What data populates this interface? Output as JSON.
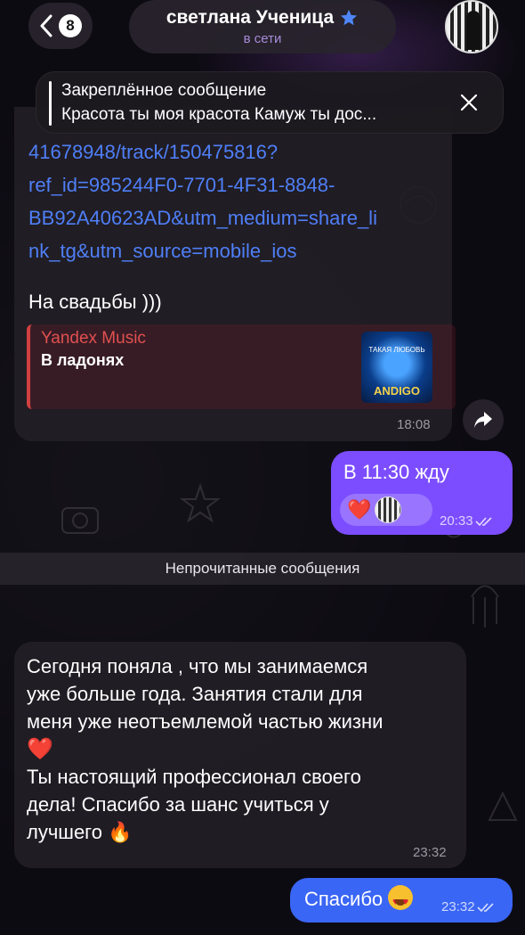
{
  "header": {
    "unread_count": "8",
    "chat_name": "светлана Ученица",
    "status": "в сети",
    "star_icon": "star-icon",
    "back_icon": "chevron-left-icon"
  },
  "pinned": {
    "title": "Закреплённое сообщение",
    "text": "Красота ты моя красота Камуж ты дос..."
  },
  "messages": [
    {
      "link": "41678948/track/150475816?ref_id=985244F0-7701-4F31-8848-BB92A40623AD&utm_medium=share_link_tg&utm_source=mobile_ios",
      "link_lines": [
        "41678948/track/150475816?",
        "ref_id=985244F0-7701-4F31-8848-",
        "BB92A40623AD&utm_medium=share_li",
        "nk_tg&utm_source=mobile_ios"
      ],
      "text": "На свадьбы )))",
      "preview": {
        "site": "Yandex Music",
        "title": "В ладонях",
        "cover_title": "ТАКАЯ ЛЮБОВЬ",
        "cover_artist": "ANDIGO"
      },
      "time": "18:08"
    },
    {
      "text": "В 11:30 жду",
      "reaction": "❤️",
      "time": "20:33"
    },
    {
      "text_lines": [
        "Сегодня поняла , что мы занимаемся",
        "уже больше года. Занятия стали для",
        "меня уже неотъемлемой частью жизни",
        "❤️",
        "Ты настоящий профессионал своего",
        "дела! Спасибо за шанс учиться у",
        "лучшего 🔥"
      ],
      "time": "23:32"
    },
    {
      "text": "Спасибо",
      "emoji": "😍",
      "time": "23:32"
    }
  ],
  "unread_divider": "Непрочитанные сообщения",
  "colors": {
    "accent_purple": "#7c4dff",
    "accent_blue": "#3a66f5",
    "link": "#4f7ff7"
  }
}
